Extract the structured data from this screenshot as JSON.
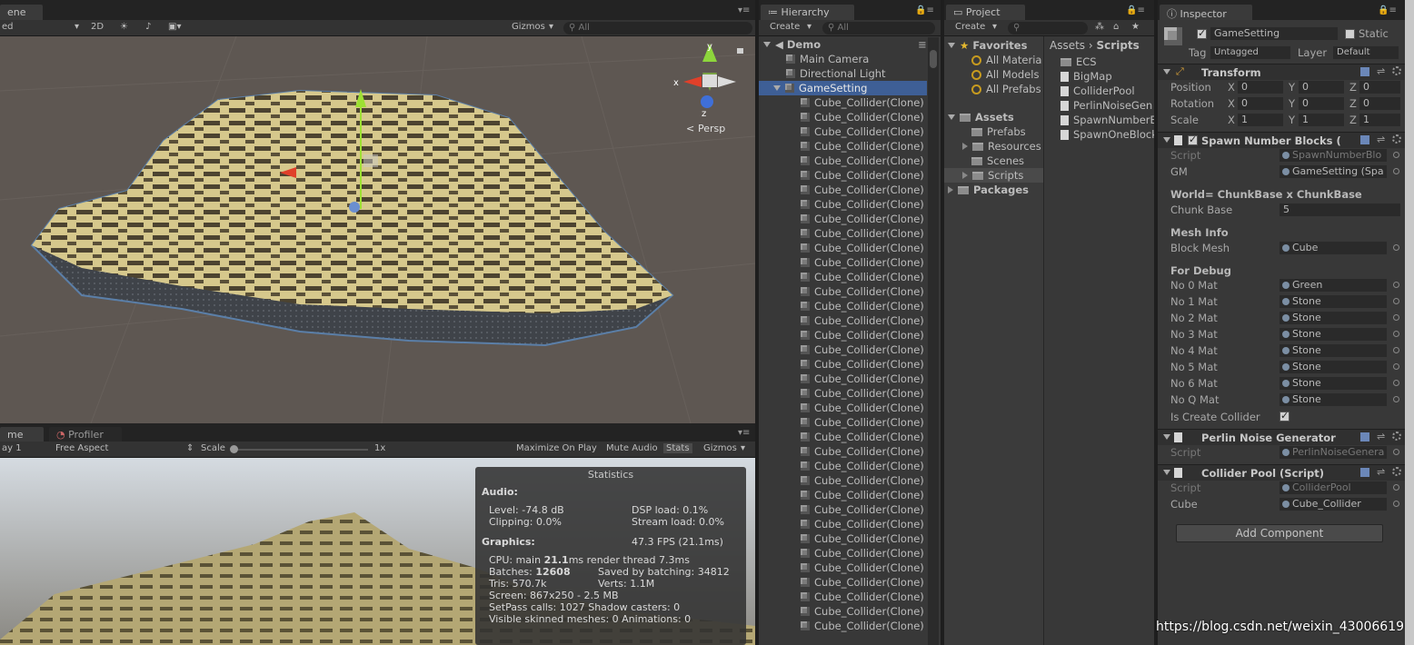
{
  "scene": {
    "tab": "ene",
    "shading_mode": "ed",
    "mode_2d": "2D",
    "gizmos": "Gizmos",
    "search_placeholder": "All",
    "persp_label": "Persp",
    "axis_y": "y",
    "axis_x": "x",
    "axis_z": "z"
  },
  "game": {
    "tab_game": "me",
    "tab_profiler": "Profiler",
    "display": "ay 1",
    "aspect": "Free Aspect",
    "scale_label": "Scale",
    "scale_value": "1x",
    "maximize": "Maximize On Play",
    "mute": "Mute Audio",
    "stats": "Stats",
    "gizmos": "Gizmos"
  },
  "statistics": {
    "title": "Statistics",
    "audio_heading": "Audio:",
    "level": "Level: -74.8 dB",
    "dsp": "DSP load: 0.1%",
    "clipping": "Clipping: 0.0%",
    "stream": "Stream load: 0.0%",
    "graphics_heading": "Graphics:",
    "fps": "47.3 FPS (21.1ms)",
    "cpu_prefix": "CPU: main ",
    "cpu_main": "21.1",
    "cpu_suffix": "ms  render thread 7.3ms",
    "batches_prefix": "Batches: ",
    "batches": "12608",
    "saved": "Saved by batching: 34812",
    "tris": "Tris: 570.7k",
    "verts": "Verts: 1.1M",
    "screen": "Screen: 867x250 - 2.5 MB",
    "setpass": "SetPass calls: 1027  Shadow casters: 0",
    "skinned": "Visible skinned meshes: 0  Animations: 0"
  },
  "hierarchy": {
    "tab": "Hierarchy",
    "create": "Create",
    "search_placeholder": "All",
    "scene_name": "Demo",
    "items": [
      "Main Camera",
      "Directional Light",
      "GameSetting"
    ],
    "clone_label": "Cube_Collider(Clone)",
    "clone_rows": [
      "Cube_Collider(Clone)",
      "Cube_Collider(Clone)",
      "Cube_Collider(Clone)",
      "Cube_Collider(Clone)",
      "Cube_Collider(Clone)",
      "Cube_Collider(Clone)",
      "Cube_Collider(Clone)",
      "Cube_Collider(Clone)",
      "Cube_Collider(Clone)",
      "Cube_Collider(Clone)",
      "Cube_Collider(Clone)",
      "Cube_Collider(Clone)",
      "Cube_Collider(Clone)",
      "Cube_Collider(Clone)",
      "Cube_Collider(Clone)",
      "Cube_Collider(Clone)",
      "Cube_Collider(Clone)",
      "Cube_Collider(Clone)",
      "Cube_Collider(Clone)",
      "Cube_Collider(Clone)",
      "Cube_Collider(Clone)",
      "Cube_Collider(Clone)",
      "Cube_Collider(Clone)",
      "Cube_Collider(Clone)",
      "Cube_Collider(Clone)",
      "Cube_Collider(Clone)",
      "Cube_Collider(Clone)",
      "Cube_Collider(Clone)",
      "Cube_Collider(Clone)",
      "Cube_Collider(Clone)",
      "Cube_Collider(Clone)",
      "Cube_Collider(Clone)",
      "Cube_Collider(Clone)",
      "Cube_Collider(Clone)",
      "Cube_Collider(Clone)",
      "Cube_Collider(Clone)",
      "Cube_Collider(Clone)"
    ]
  },
  "project": {
    "tab": "Project",
    "create": "Create",
    "favorites": "Favorites",
    "fav_items": [
      "All Materia",
      "All Models",
      "All Prefabs"
    ],
    "assets": "Assets",
    "asset_folders": [
      "Prefabs",
      "Resources",
      "Scenes",
      "Scripts"
    ],
    "packages": "Packages",
    "breadcrumb_assets": "Assets",
    "breadcrumb_sep": "›",
    "breadcrumb_scripts": "Scripts",
    "files": [
      "ECS",
      "BigMap",
      "ColliderPool",
      "PerlinNoiseGen",
      "SpawnNumberB",
      "SpawnOneBlock"
    ]
  },
  "inspector": {
    "tab": "Inspector",
    "object_name": "GameSetting",
    "static_label": "Static",
    "tag_label": "Tag",
    "tag_value": "Untagged",
    "layer_label": "Layer",
    "layer_value": "Default",
    "transform": {
      "title": "Transform",
      "position_label": "Position",
      "rotation_label": "Rotation",
      "scale_label": "Scale",
      "x": "X",
      "y": "Y",
      "z": "Z",
      "position": [
        "0",
        "0",
        "0"
      ],
      "rotation": [
        "0",
        "0",
        "0"
      ],
      "scale": [
        "1",
        "1",
        "1"
      ]
    },
    "spawn": {
      "title": "Spawn Number Blocks (",
      "script_label": "Script",
      "script_value": "SpawnNumberBlo",
      "gm_label": "GM",
      "gm_value": "GameSetting (Spa",
      "world_title": "World= ChunkBase x ChunkBase",
      "chunk_label": "Chunk Base",
      "chunk_value": "5",
      "mesh_title": "Mesh Info",
      "block_mesh_label": "Block Mesh",
      "block_mesh_value": "Cube",
      "debug_title": "For Debug",
      "mats": [
        {
          "label": "No 0 Mat",
          "value": "Green"
        },
        {
          "label": "No 1 Mat",
          "value": "Stone"
        },
        {
          "label": "No 2 Mat",
          "value": "Stone"
        },
        {
          "label": "No 3 Mat",
          "value": "Stone"
        },
        {
          "label": "No 4 Mat",
          "value": "Stone"
        },
        {
          "label": "No 5 Mat",
          "value": "Stone"
        },
        {
          "label": "No 6 Mat",
          "value": "Stone"
        },
        {
          "label": "No Q Mat",
          "value": "Stone"
        }
      ],
      "collider_label": "Is Create Collider"
    },
    "perlin": {
      "title": "Perlin Noise Generator",
      "script_label": "Script",
      "script_value": "PerlinNoiseGenera"
    },
    "pool": {
      "title": "Collider Pool (Script)",
      "script_label": "Script",
      "script_value": "ColliderPool",
      "cube_label": "Cube",
      "cube_value": "Cube_Collider"
    },
    "add_component": "Add Component"
  },
  "watermark": "https://blog.csdn.net/weixin_43006619"
}
